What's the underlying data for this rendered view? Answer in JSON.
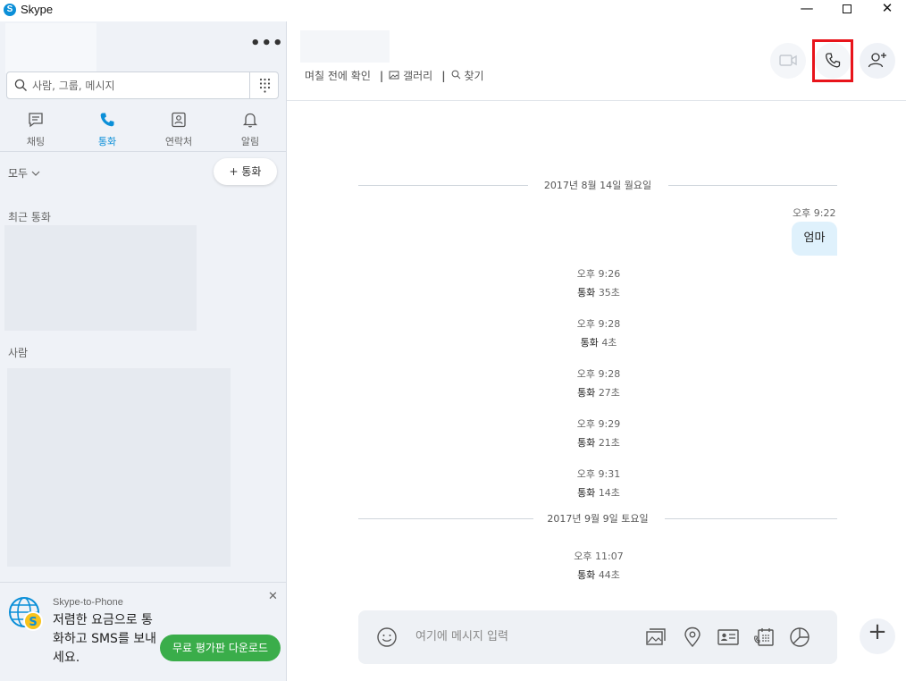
{
  "window": {
    "title": "Skype",
    "logo_letter": "S",
    "minimize": "—",
    "close": "✕"
  },
  "sidebar": {
    "more": "•••",
    "search_placeholder": "사람, 그룹, 메시지",
    "tabs": [
      {
        "label": "채팅",
        "icon": "chat-icon"
      },
      {
        "label": "통화",
        "icon": "phone-icon",
        "active": true
      },
      {
        "label": "연락처",
        "icon": "contacts-icon"
      },
      {
        "label": "알림",
        "icon": "bell-icon"
      }
    ],
    "filter": "모두",
    "new_call": "+ 통화",
    "recent_calls_title": "최근 통화",
    "people_title": "사람",
    "promo": {
      "heading": "Skype-to-Phone",
      "body": "저렴한 요금으로 통화하고 SMS를 보내세요.",
      "button": "무료 평가판 다운로드",
      "close": "✕"
    }
  },
  "conversation": {
    "subnav": [
      "며칠 전에 확인",
      "갤러리",
      "찾기"
    ],
    "date_separators": [
      "2017년 8월 14일 월요일",
      "2017년 9월 9일 토요일"
    ],
    "outgoing": {
      "time": "오후 9:22",
      "text": "엄마"
    },
    "calls": [
      {
        "time": "오후 9:26",
        "label": "통화",
        "duration": "35초"
      },
      {
        "time": "오후 9:28",
        "label": "통화",
        "duration": "4초"
      },
      {
        "time": "오후 9:28",
        "label": "통화",
        "duration": "27초"
      },
      {
        "time": "오후 9:29",
        "label": "통화",
        "duration": "21초"
      },
      {
        "time": "오후 9:31",
        "label": "통화",
        "duration": "14초"
      },
      {
        "time": "오후 11:07",
        "label": "통화",
        "duration": "44초"
      }
    ],
    "composer_placeholder": "여기에 메시지 입력",
    "plus": "+"
  },
  "colors": {
    "accent": "#0b8fd8",
    "highlight": "#e8141b",
    "promo_button": "#3aad4a",
    "bubble": "#dff1fc"
  }
}
